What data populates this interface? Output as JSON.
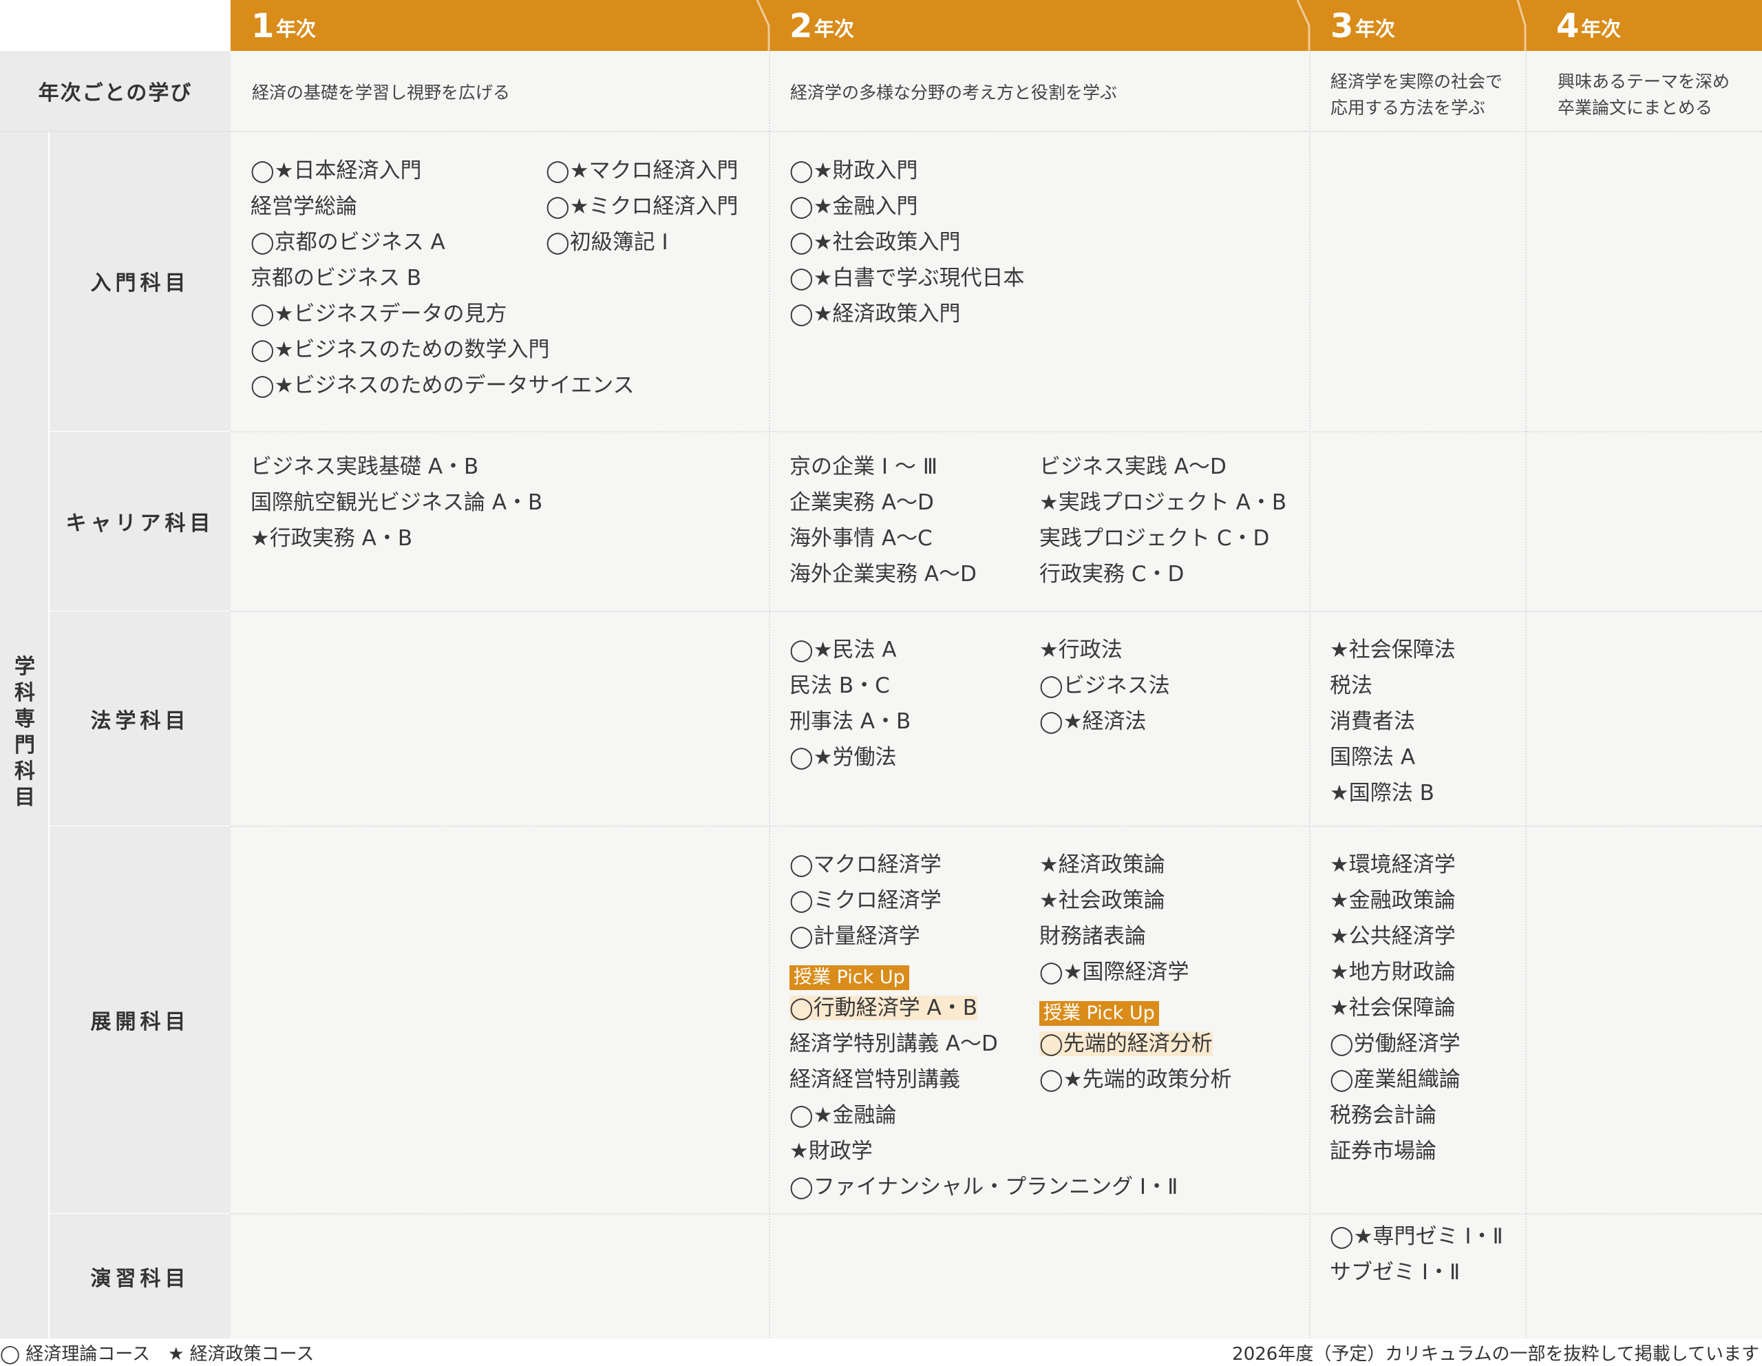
{
  "colors": {
    "accent": "#d98c1a",
    "cell_bg": "#f6f7f5",
    "label_bg": "#ebebeb",
    "highlight": "#fbead0"
  },
  "years": [
    {
      "num": "1",
      "label": "年次"
    },
    {
      "num": "2",
      "label": "年次"
    },
    {
      "num": "3",
      "label": "年次"
    },
    {
      "num": "4",
      "label": "年次"
    }
  ],
  "learning": {
    "label": "年次ごとの学び",
    "y1": "経済の基礎を学習し視野を広げる",
    "y2": "経済学の多様な分野の考え方と役割を学ぶ",
    "y3_l1": "経済学を実際の社会で",
    "y3_l2": "応用する方法を学ぶ",
    "y4_l1": "興味あるテーマを深め",
    "y4_l2": "卒業論文にまとめる"
  },
  "group_label": "学科専門科目",
  "rows": {
    "intro": {
      "label": "入門科目",
      "y1_a": [
        "◯★日本経済入門",
        "経営学総論",
        "◯京都のビジネス A",
        "京都のビジネス B",
        "◯★ビジネスデータの見方",
        "◯★ビジネスのための数学入門",
        "◯★ビジネスのためのデータサイエンス"
      ],
      "y1_b": [
        "◯★マクロ経済入門",
        "◯★ミクロ経済入門",
        "◯初級簿記 Ⅰ"
      ],
      "y2_a": [
        "◯★財政入門",
        "◯★金融入門",
        "◯★社会政策入門",
        "◯★白書で学ぶ現代日本",
        "◯★経済政策入門"
      ]
    },
    "career": {
      "label": "キャリア科目",
      "y1_a": [
        "ビジネス実践基礎 A・B",
        "国際航空観光ビジネス論 A・B",
        "★行政実務 A・B"
      ],
      "y2_a": [
        "京の企業 Ⅰ ～ Ⅲ",
        "企業実務 A～D",
        "海外事情 A～C",
        "海外企業実務 A～D"
      ],
      "y2_b": [
        "ビジネス実践 A～D",
        "★実践プロジェクト A・B",
        "実践プロジェクト C・D",
        "行政実務 C・D"
      ]
    },
    "law": {
      "label": "法学科目",
      "y2_a": [
        "◯★民法 A",
        "民法 B・C",
        "刑事法 A・B",
        "◯★労働法"
      ],
      "y2_b": [
        "★行政法",
        "◯ビジネス法",
        "◯★経済法"
      ],
      "y3_a": [
        "★社会保障法",
        "税法",
        "消費者法",
        "国際法 A",
        "★国際法 B"
      ]
    },
    "adv": {
      "label": "展開科目",
      "y2_a1": [
        "◯マクロ経済学",
        "◯ミクロ経済学",
        "◯計量経済学"
      ],
      "pickup": "授業 Pick Up",
      "y2_a_pick": "◯行動経済学 A・B",
      "y2_a2": [
        "経済学特別講義 A～D",
        "経済経営特別講義",
        "◯★金融論",
        "★財政学",
        "◯ファイナンシャル・プランニング Ⅰ・Ⅱ"
      ],
      "y2_b1": [
        "★経済政策論",
        "★社会政策論",
        "財務諸表論",
        "◯★国際経済学"
      ],
      "y2_b_pick": "◯先端的経済分析",
      "y2_b2": [
        "◯★先端的政策分析"
      ],
      "y3_a": [
        "★環境経済学",
        "★金融政策論",
        "★公共経済学",
        "★地方財政論",
        "★社会保障論",
        "◯労働経済学",
        "◯産業組織論",
        "税務会計論",
        "証券市場論"
      ]
    },
    "seminar": {
      "label": "演習科目",
      "y3_a": [
        "◯★専門ゼミ Ⅰ・Ⅱ",
        "サブゼミ Ⅰ・Ⅱ"
      ]
    }
  },
  "footer": {
    "legend": "◯ 経済理論コース　★ 経済政策コース",
    "note": "2026年度（予定）カリキュラムの一部を抜粋して掲載しています"
  }
}
